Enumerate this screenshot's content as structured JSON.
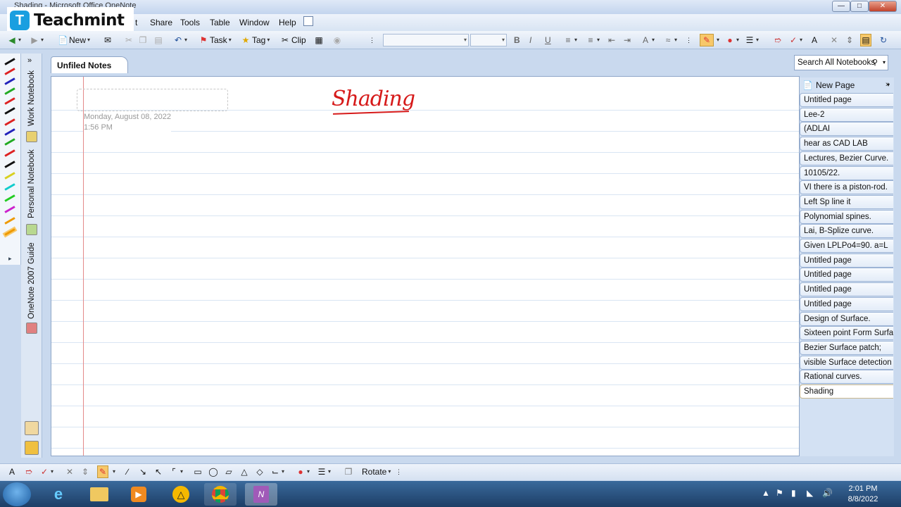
{
  "window": {
    "title": "Shading - Microsoft Office OneNote"
  },
  "logo": {
    "text": "Teachmint",
    "mark": "T"
  },
  "menu": [
    "t",
    "Share",
    "Tools",
    "Table",
    "Window",
    "Help"
  ],
  "toolbar": {
    "new_label": "New",
    "task_label": "Task",
    "tag_label": "Tag",
    "clip_label": "Clip"
  },
  "section_tab": "Unfiled Notes",
  "search_placeholder": "Search All Notebooks",
  "notebooks": [
    "Work Notebook",
    "Personal Notebook",
    "OneNote 2007 Guide"
  ],
  "page": {
    "date": "Monday, August 08, 2022",
    "time": "1:56 PM",
    "handwritten_title": "Shading"
  },
  "page_list": {
    "new_page_label": "New Page",
    "items": [
      "Untitled page",
      "Lee-2",
      "(ADLAI",
      "hear as CAD LAB",
      "Lectures, Bezier Curve.",
      "10105/22.",
      "VI there is a piston-rod.",
      "Left Sp line it",
      "Polynomial spines.",
      "Lai, B-Splize curve.",
      "Given LPLPo4=90. a=L",
      "Untitled page",
      "Untitled page",
      "Untitled page",
      "Untitled page",
      "Design of Surface.",
      "Sixteen point Form Surfa",
      "Bezier Surface patch;",
      "visible Surface detection",
      "Rational curves.",
      "Shading"
    ],
    "active_index": 20
  },
  "bottom_toolbar": {
    "rotate_label": "Rotate"
  },
  "taskbar": {
    "time": "2:01 PM",
    "date": "8/8/2022"
  },
  "colors": {
    "accent_red": "#d61a1a",
    "margin_red": "#e48a8a",
    "ruled_line": "#d9e5f3"
  }
}
